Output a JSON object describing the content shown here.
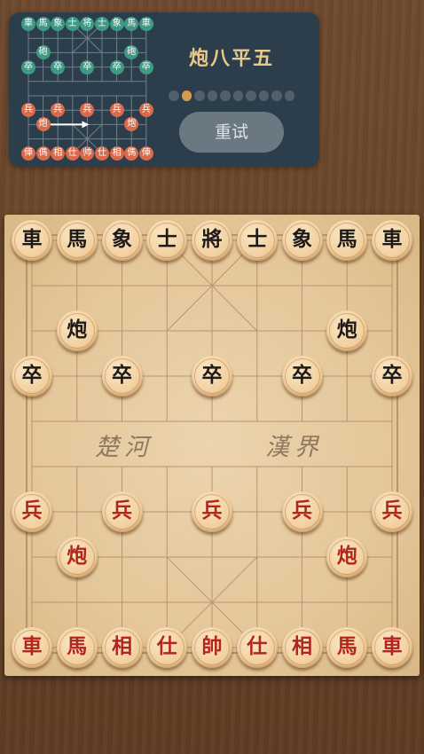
{
  "move_title": "炮八平五",
  "progress": {
    "total_steps": 10,
    "current_step": 2
  },
  "retry_label": "重试",
  "river": {
    "left": "楚河",
    "right": "漢界"
  },
  "colors": {
    "panel": "#2c3e4c",
    "accent": "#d59a4e",
    "red_piece_text": "#b3261e",
    "black_piece_text": "#1e1a17"
  },
  "mini_board": {
    "black_back_row": [
      "車",
      "馬",
      "象",
      "士",
      "将",
      "士",
      "象",
      "馬",
      "車"
    ],
    "black_cannons": [
      {
        "file": 1,
        "rank": 2,
        "label": "砲"
      },
      {
        "file": 7,
        "rank": 2,
        "label": "砲"
      }
    ],
    "black_soldiers": [
      {
        "file": 0,
        "label": "卒"
      },
      {
        "file": 2,
        "label": "卒"
      },
      {
        "file": 4,
        "label": "卒"
      },
      {
        "file": 6,
        "label": "卒"
      },
      {
        "file": 8,
        "label": "卒"
      }
    ],
    "red_soldiers": [
      {
        "file": 0,
        "label": "兵"
      },
      {
        "file": 2,
        "label": "兵"
      },
      {
        "file": 4,
        "label": "兵"
      },
      {
        "file": 6,
        "label": "兵"
      },
      {
        "file": 8,
        "label": "兵"
      }
    ],
    "red_cannons": [
      {
        "file": 1,
        "rank": 7,
        "label": "炮"
      },
      {
        "file": 7,
        "rank": 7,
        "label": "炮"
      }
    ],
    "red_back_row": [
      "俥",
      "傌",
      "相",
      "仕",
      "帅",
      "仕",
      "相",
      "傌",
      "俥"
    ],
    "hint_arrow": {
      "from_file": 1,
      "to_file": 4,
      "rank": 7
    }
  },
  "board": {
    "black_back_row": [
      "車",
      "馬",
      "象",
      "士",
      "將",
      "士",
      "象",
      "馬",
      "車"
    ],
    "black_cannons": [
      {
        "file": 1,
        "rank": 2,
        "label": "炮"
      },
      {
        "file": 7,
        "rank": 2,
        "label": "炮"
      }
    ],
    "black_soldiers": [
      {
        "file": 0,
        "label": "卒"
      },
      {
        "file": 2,
        "label": "卒"
      },
      {
        "file": 4,
        "label": "卒"
      },
      {
        "file": 6,
        "label": "卒"
      },
      {
        "file": 8,
        "label": "卒"
      }
    ],
    "red_soldiers": [
      {
        "file": 0,
        "label": "兵"
      },
      {
        "file": 2,
        "label": "兵"
      },
      {
        "file": 4,
        "label": "兵"
      },
      {
        "file": 6,
        "label": "兵"
      },
      {
        "file": 8,
        "label": "兵"
      }
    ],
    "red_cannons": [
      {
        "file": 1,
        "rank": 7,
        "label": "炮"
      },
      {
        "file": 7,
        "rank": 7,
        "label": "炮"
      }
    ],
    "red_back_row": [
      "車",
      "馬",
      "相",
      "仕",
      "帥",
      "仕",
      "相",
      "馬",
      "車"
    ]
  }
}
